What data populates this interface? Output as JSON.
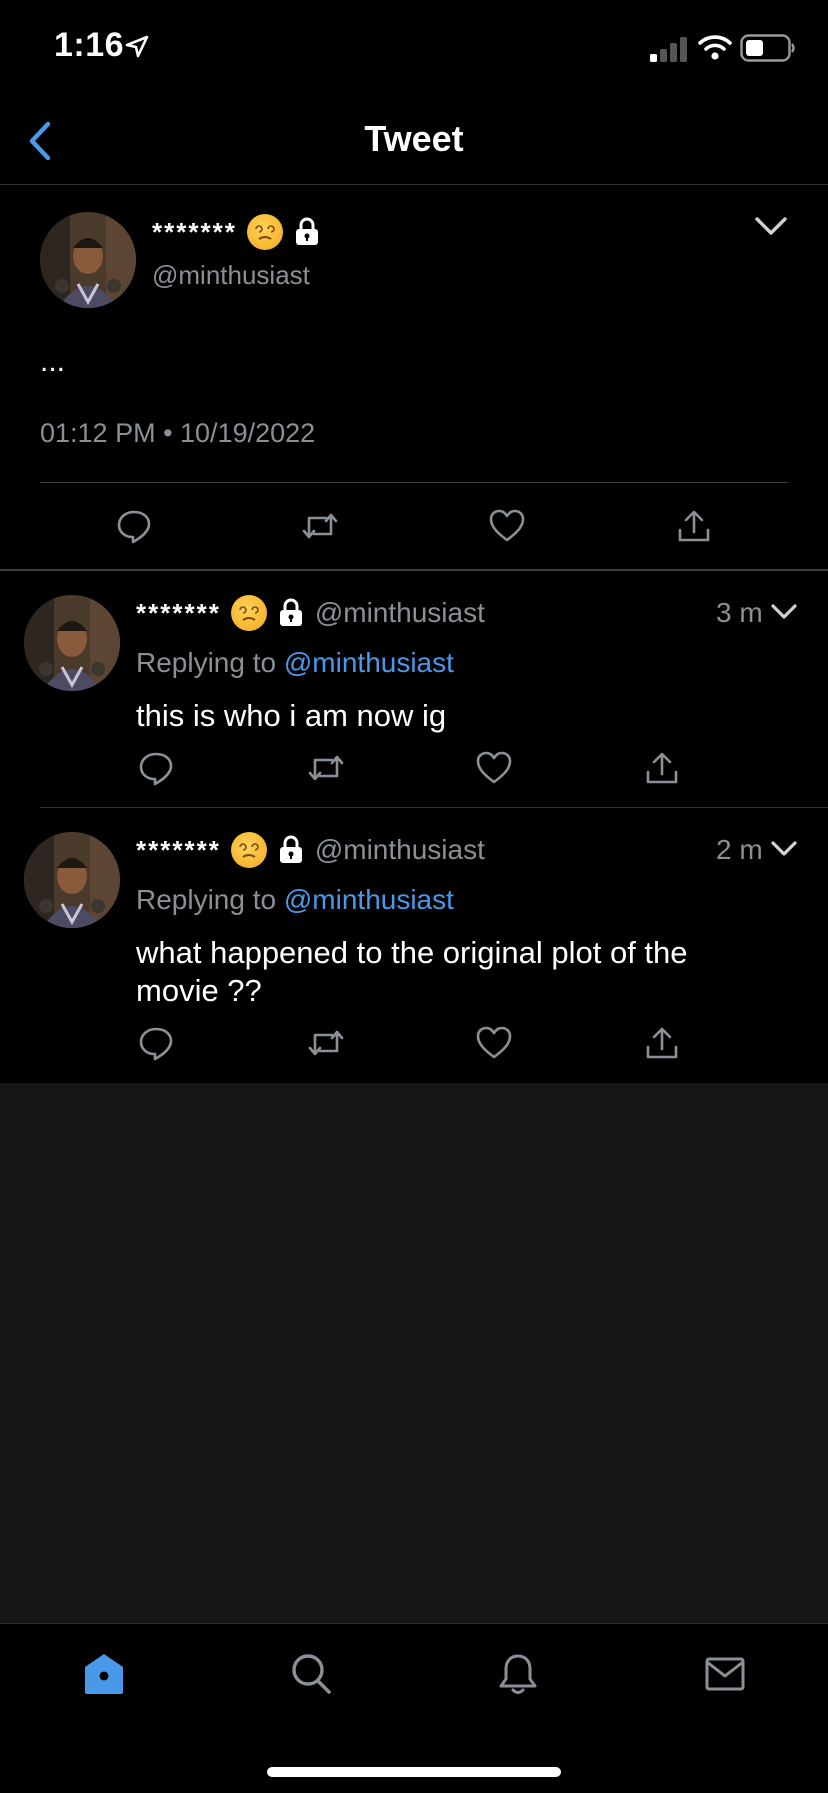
{
  "status_bar": {
    "time": "1:16"
  },
  "header": {
    "title": "Tweet"
  },
  "main_tweet": {
    "name": "*******",
    "handle": "@minthusiast",
    "text": "...",
    "timestamp": "01:12 PM • 10/19/2022"
  },
  "replies": [
    {
      "name": "*******",
      "handle": "@minthusiast",
      "time": "3 m",
      "replying_prefix": "Replying to",
      "replying_to": "@minthusiast",
      "text": "this is who i am now ig"
    },
    {
      "name": "*******",
      "handle": "@minthusiast",
      "time": "2 m",
      "replying_prefix": "Replying to",
      "replying_to": "@minthusiast",
      "text": "what happened to the original plot of the movie ??"
    }
  ],
  "icons": {
    "action_bar": [
      "reply-icon",
      "retweet-icon",
      "like-icon",
      "share-icon"
    ],
    "tab_bar": [
      "home-icon",
      "search-icon",
      "notifications-icon",
      "messages-icon"
    ]
  },
  "colors": {
    "background": "#000000",
    "accent": "#4a99e9",
    "secondary_text": "#8b9096",
    "empty_area": "#151618"
  }
}
